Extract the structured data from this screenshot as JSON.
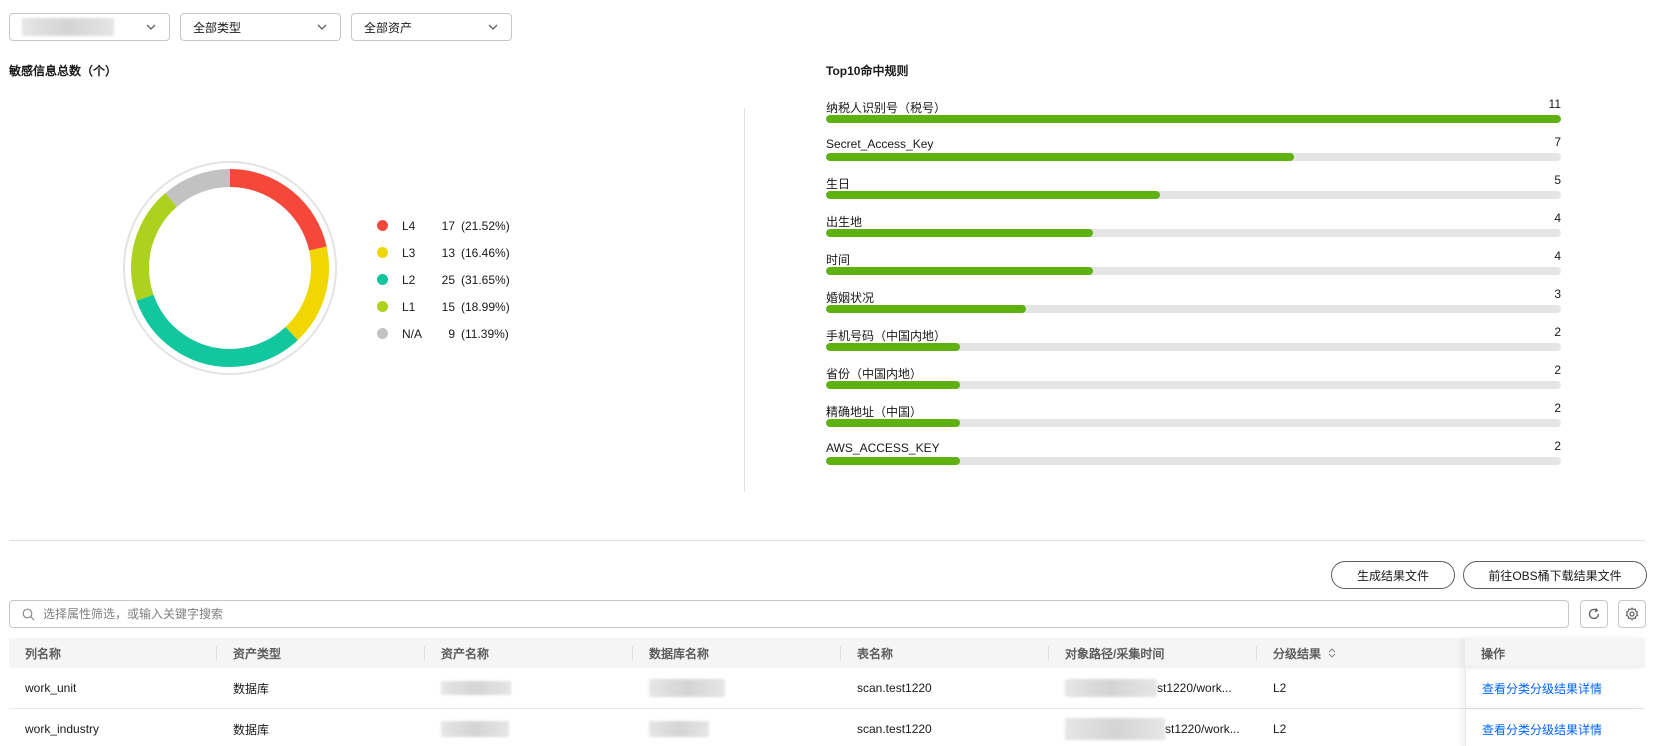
{
  "filters": {
    "scope_value": "",
    "type_value": "全部类型",
    "asset_value": "全部资产"
  },
  "donut": {
    "title": "敏感信息总数（个）",
    "colors": {
      "L4": "#f5483b",
      "L3": "#f2d600",
      "L2": "#12c69d",
      "L1": "#acd21f",
      "NA": "#c2c2c2"
    },
    "legend": [
      {
        "label": "L4",
        "count": "17",
        "pct": "(21.52%)",
        "value": 17,
        "color": "#f5483b"
      },
      {
        "label": "L3",
        "count": "13",
        "pct": "(16.46%)",
        "value": 13,
        "color": "#f2d600"
      },
      {
        "label": "L2",
        "count": "25",
        "pct": "(31.65%)",
        "value": 25,
        "color": "#12c69d"
      },
      {
        "label": "L1",
        "count": "15",
        "pct": "(18.99%)",
        "value": 15,
        "color": "#acd21f"
      },
      {
        "label": "N/A",
        "count": "9",
        "pct": "(11.39%)",
        "value": 9,
        "color": "#c2c2c2"
      }
    ]
  },
  "top_rules": {
    "title": "Top10命中规则",
    "max": 11,
    "items": [
      {
        "name": "纳税人识别号（税号）",
        "value": 11
      },
      {
        "name": "Secret_Access_Key",
        "value": 7
      },
      {
        "name": "生日",
        "value": 5
      },
      {
        "name": "出生地",
        "value": 4
      },
      {
        "name": "时间",
        "value": 4
      },
      {
        "name": "婚姻状况",
        "value": 3
      },
      {
        "name": "手机号码（中国内地）",
        "value": 2
      },
      {
        "name": "省份（中国内地）",
        "value": 2
      },
      {
        "name": "精确地址（中国）",
        "value": 2
      },
      {
        "name": "AWS_ACCESS_KEY",
        "value": 2
      }
    ],
    "bar_color": "#5eb10e"
  },
  "actions": {
    "generate_label": "生成结果文件",
    "goto_obs_label": "前往OBS桶下载结果文件"
  },
  "search": {
    "placeholder": "选择属性筛选，或输入关键字搜索"
  },
  "table": {
    "columns": [
      "列名称",
      "资产类型",
      "资产名称",
      "数据库名称",
      "表名称",
      "对象路径/采集时间",
      "分级结果",
      "操作"
    ],
    "rows": [
      {
        "column": "work_unit",
        "asset_type": "数据库",
        "table": "scan.test1220",
        "path": "st1220/work...",
        "level": "L2",
        "op": "查看分类分级结果详情"
      },
      {
        "column": "work_industry",
        "asset_type": "数据库",
        "table": "scan.test1220",
        "path": "st1220/work...",
        "level": "L2",
        "op": "查看分类分级结果详情"
      }
    ]
  }
}
